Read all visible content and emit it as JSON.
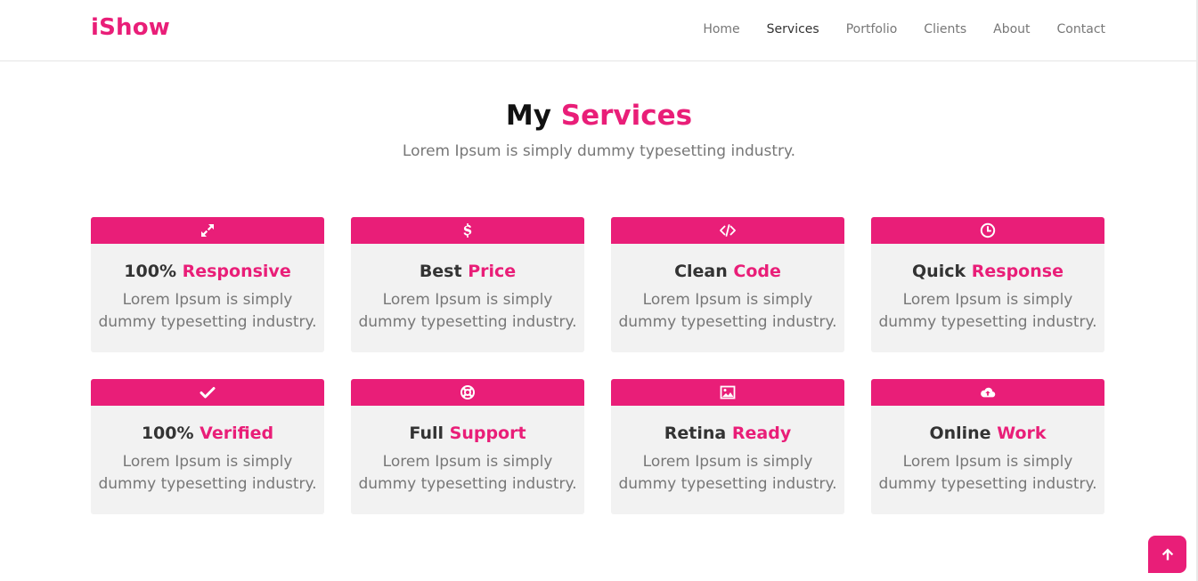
{
  "brand": {
    "name": "iShow",
    "color": "#e91e78"
  },
  "nav": {
    "items": [
      {
        "label": "Home",
        "active": false
      },
      {
        "label": "Services",
        "active": true
      },
      {
        "label": "Portfolio",
        "active": false
      },
      {
        "label": "Clients",
        "active": false
      },
      {
        "label": "About",
        "active": false
      },
      {
        "label": "Contact",
        "active": false
      }
    ]
  },
  "section": {
    "title_main": "My",
    "title_accent": "Services",
    "subtitle": "Lorem Ipsum is simply dummy typesetting industry."
  },
  "services": [
    {
      "icon": "expand-arrows-icon",
      "title_main": "100%",
      "title_accent": "Responsive",
      "text": "Lorem Ipsum is simply dummy typesetting industry."
    },
    {
      "icon": "dollar-icon",
      "title_main": "Best",
      "title_accent": "Price",
      "text": "Lorem Ipsum is simply dummy typesetting industry."
    },
    {
      "icon": "code-icon",
      "title_main": "Clean",
      "title_accent": "Code",
      "text": "Lorem Ipsum is simply dummy typesetting industry."
    },
    {
      "icon": "clock-icon",
      "title_main": "Quick",
      "title_accent": "Response",
      "text": "Lorem Ipsum is simply dummy typesetting industry."
    },
    {
      "icon": "check-icon",
      "title_main": "100%",
      "title_accent": "Verified",
      "text": "Lorem Ipsum is simply dummy typesetting industry."
    },
    {
      "icon": "life-ring-icon",
      "title_main": "Full",
      "title_accent": "Support",
      "text": "Lorem Ipsum is simply dummy typesetting industry."
    },
    {
      "icon": "image-icon",
      "title_main": "Retina",
      "title_accent": "Ready",
      "text": "Lorem Ipsum is simply dummy typesetting industry."
    },
    {
      "icon": "cloud-upload-icon",
      "title_main": "Online",
      "title_accent": "Work",
      "text": "Lorem Ipsum is simply dummy typesetting industry."
    }
  ],
  "scroll_top": {
    "icon": "arrow-up-icon"
  },
  "colors": {
    "accent": "#e91e78",
    "card_bg": "#f2f2f2",
    "muted_text": "#777777"
  }
}
